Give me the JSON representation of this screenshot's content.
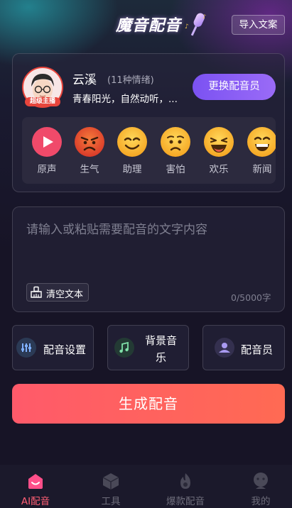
{
  "header": {
    "app_title": "魔音配音",
    "import_label": "导入文案"
  },
  "voice": {
    "avatar_badge": "超级主播",
    "name": "云溪",
    "emotion_count": "(11种情绪)",
    "description": "青春阳光，自然动听，...",
    "change_label": "更换配音员"
  },
  "emotions": [
    {
      "label": "原声",
      "icon": "play-icon"
    },
    {
      "label": "生气",
      "icon": "angry-face-icon"
    },
    {
      "label": "助理",
      "icon": "smile-face-icon"
    },
    {
      "label": "害怕",
      "icon": "worried-face-icon"
    },
    {
      "label": "欢乐",
      "icon": "laugh-face-icon"
    },
    {
      "label": "新闻",
      "icon": "grin-face-icon"
    }
  ],
  "editor": {
    "placeholder": "请输入或粘贴需要配音的文字内容",
    "clear_label": "清空文本",
    "char_count": "0/5000字"
  },
  "options": {
    "settings_label": "配音设置",
    "bgm_label_line1": "背景音",
    "bgm_label_line2": "乐",
    "voice_actor_label": "配音员"
  },
  "generate_label": "生成配音",
  "nav": [
    {
      "label": "AI配音",
      "icon": "home-icon",
      "active": true
    },
    {
      "label": "工具",
      "icon": "cube-icon",
      "active": false
    },
    {
      "label": "爆款配音",
      "icon": "flame-icon",
      "active": false
    },
    {
      "label": "我的",
      "icon": "profile-icon",
      "active": false
    }
  ],
  "colors": {
    "accent": "#ff5f74",
    "purple_button": "#7b52f2",
    "background": "#171426"
  }
}
